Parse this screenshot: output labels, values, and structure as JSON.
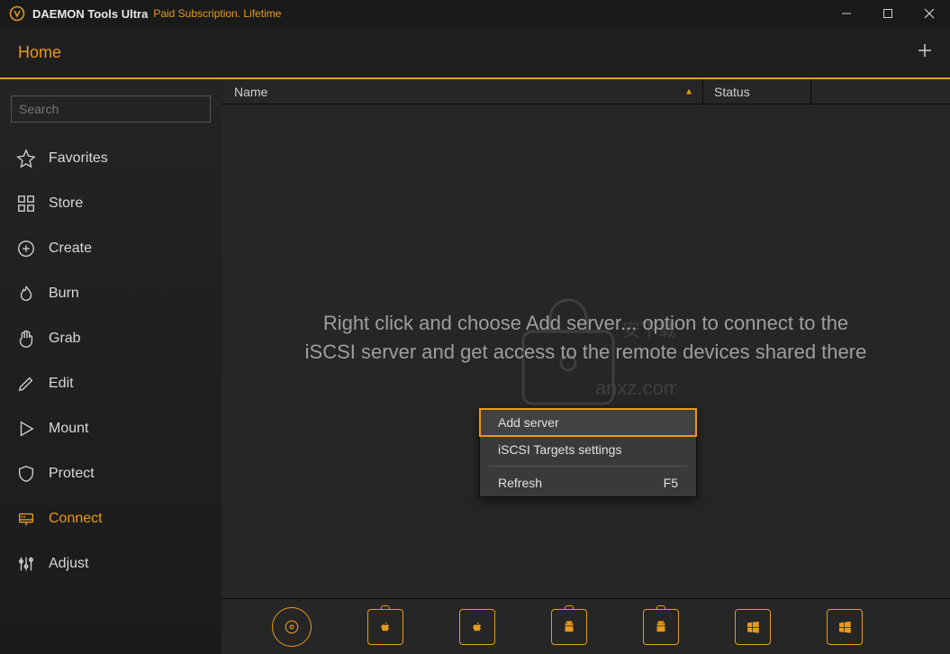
{
  "titlebar": {
    "app_name": "DAEMON Tools Ultra",
    "subscription_text": "Paid Subscription. Lifetime"
  },
  "menubar": {
    "home_label": "Home"
  },
  "sidebar": {
    "search_placeholder": "Search",
    "items": [
      {
        "label": "Favorites"
      },
      {
        "label": "Store"
      },
      {
        "label": "Create"
      },
      {
        "label": "Burn"
      },
      {
        "label": "Grab"
      },
      {
        "label": "Edit"
      },
      {
        "label": "Mount"
      },
      {
        "label": "Protect"
      },
      {
        "label": "Connect"
      },
      {
        "label": "Adjust"
      }
    ]
  },
  "columns": {
    "name": "Name",
    "status": "Status"
  },
  "empty_message": {
    "line1": "Right click and choose Add server... option to connect to the",
    "line2": "iSCSI server and get access to the remote devices shared there"
  },
  "context_menu": {
    "add_server": "Add server",
    "iscsi_settings": "iSCSI Targets settings",
    "refresh": "Refresh",
    "refresh_shortcut": "F5"
  },
  "watermark_text": "anxz.com"
}
